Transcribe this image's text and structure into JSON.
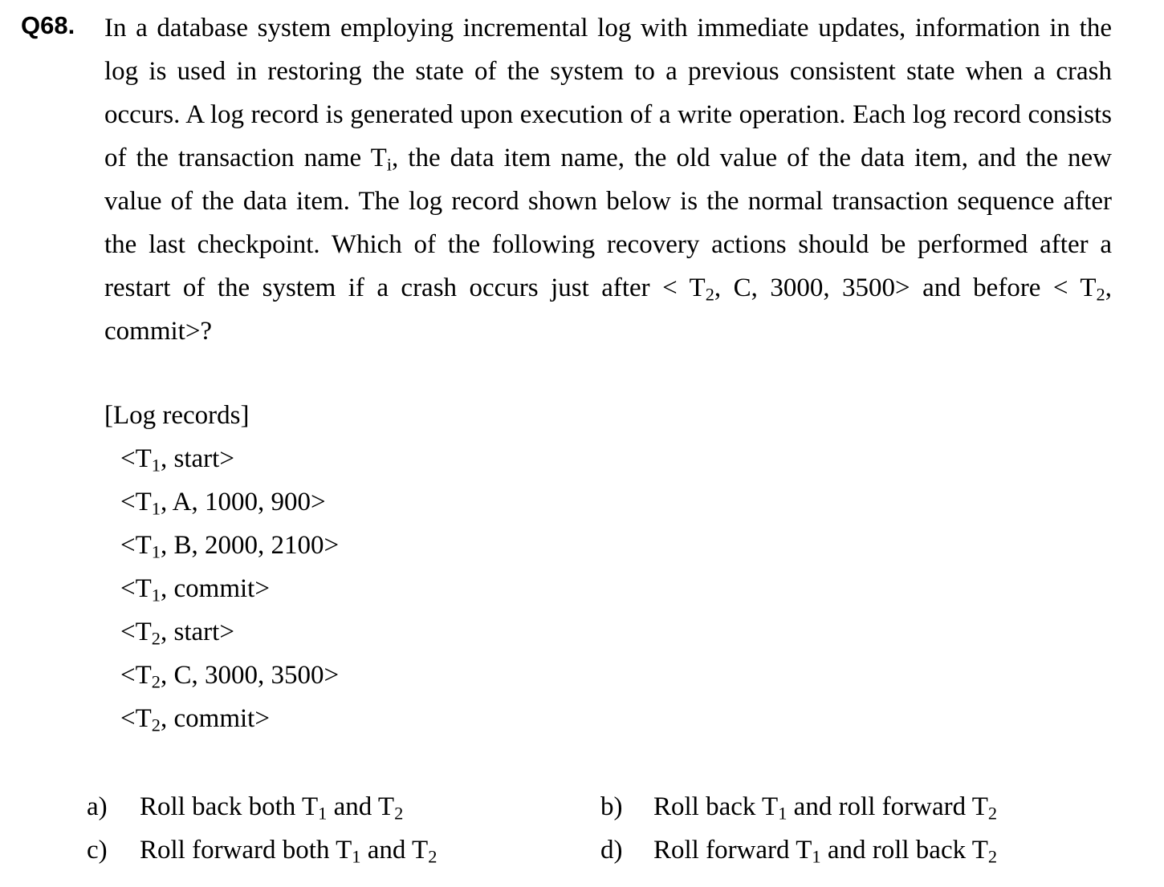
{
  "question": {
    "number": "Q68.",
    "stem_1": "In a database system employing incremental log with immediate updates, information in the log is used in restoring the state of the system to a previous consistent state when a crash occurs.   A log record is generated upon execution of a write operation.   Each log record consists of the transaction name T",
    "stem_sub_i": "i",
    "stem_2": ", the data item name, the old value of the data item, and the new value of the data item. The log record shown below is the normal transaction sequence after the last checkpoint.   Which of the following recovery actions should be performed after a restart of the system if a crash occurs just after < T",
    "stem_sub_2a": "2",
    "stem_3": ", C, 3000, 3500> and before < T",
    "stem_sub_2b": "2",
    "stem_4": ", commit>?"
  },
  "log": {
    "title": "[Log records]",
    "records": [
      {
        "pre": "<T",
        "sub": "1",
        "post": ", start>"
      },
      {
        "pre": "<T",
        "sub": "1",
        "post": ", A, 1000, 900>"
      },
      {
        "pre": "<T",
        "sub": "1",
        "post": ", B, 2000, 2100>"
      },
      {
        "pre": "<T",
        "sub": "1",
        "post": ", commit>"
      },
      {
        "pre": "<T",
        "sub": "2",
        "post": ", start>"
      },
      {
        "pre": "<T",
        "sub": "2",
        "post": ", C, 3000, 3500>"
      },
      {
        "pre": "<T",
        "sub": "2",
        "post": ", commit>"
      }
    ]
  },
  "options": {
    "a": {
      "letter": "a)",
      "t1": "Roll back both T",
      "s1": "1",
      "t2": " and T",
      "s2": "2"
    },
    "b": {
      "letter": "b)",
      "t1": "Roll back T",
      "s1": "1",
      "t2": " and roll forward T",
      "s2": "2"
    },
    "c": {
      "letter": "c)",
      "t1": "Roll forward both T",
      "s1": "1",
      "t2": " and T",
      "s2": "2"
    },
    "d": {
      "letter": "d)",
      "t1": "Roll forward T",
      "s1": "1",
      "t2": " and roll back T",
      "s2": "2"
    }
  }
}
